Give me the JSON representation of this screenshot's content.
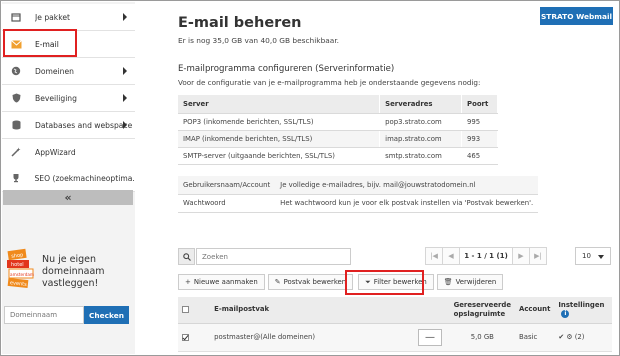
{
  "sidebar": {
    "items": [
      {
        "label": "Je pakket",
        "icon": "box-icon"
      },
      {
        "label": "E-mail",
        "icon": "envelope-icon"
      },
      {
        "label": "Domeinen",
        "icon": "globe-icon"
      },
      {
        "label": "Beveiliging",
        "icon": "shield-icon"
      },
      {
        "label": "Databases and webspace",
        "icon": "database-icon"
      },
      {
        "label": "AppWizard",
        "icon": "wand-icon"
      },
      {
        "label": "SEO (zoekmachineoptima...",
        "icon": "trophy-icon"
      }
    ],
    "collapse_label": "«",
    "promo_text": "Nu je eigen domeinnaam vastleggen!",
    "promo_image_tags": [
      "shop",
      "hotel",
      "amsterdam",
      "events"
    ],
    "domain_placeholder": "Domeinnaam",
    "check_label": "Checken"
  },
  "header": {
    "title": "E-mail beheren",
    "webmail_label": "STRATO Webmail",
    "quota_text": "Er is nog 35,0 GB van 40,0 GB beschikbaar."
  },
  "server_info": {
    "title": "E-mailprogramma configureren (Serverinformatie)",
    "description": "Voor de configuratie van je e-mailprogramma heb je onderstaande gegevens nodig:",
    "headers": [
      "Server",
      "Serveradres",
      "Poort"
    ],
    "rows": [
      [
        "POP3 (inkomende berichten, SSL/TLS)",
        "pop3.strato.com",
        "995"
      ],
      [
        "IMAP (inkomende berichten, SSL/TLS)",
        "imap.strato.com",
        "993"
      ],
      [
        "SMTP-server (uitgaande berichten, SSL/TLS)",
        "smtp.strato.com",
        "465"
      ]
    ],
    "credentials": [
      [
        "Gebruikersnaam/Account",
        "Je volledige e-mailadres, bijv. mail@jouwstratodomein.nl"
      ],
      [
        "Wachtwoord",
        "Het wachtwoord kun je voor elk postvak instellen via 'Postvak bewerken'."
      ]
    ]
  },
  "toolbar": {
    "search_placeholder": "Zoeken",
    "pager": {
      "first": "|◀",
      "prev": "◀",
      "info": "1 - 1 / 1 (1)",
      "next": "▶",
      "last": "▶|"
    },
    "per_page": "10",
    "actions": [
      {
        "label": "Nieuwe aanmaken",
        "icon": "+"
      },
      {
        "label": "Postvak bewerken",
        "icon": "✎"
      },
      {
        "label": "Filter bewerken",
        "icon": "⏷"
      },
      {
        "label": "Verwijderen",
        "icon": "🗑"
      }
    ]
  },
  "mailboxes": {
    "headers": {
      "mailbox": "E-mailpostvak",
      "reserved": "Gereserveerde opslagruimte",
      "account": "Account",
      "settings": "Instellingen"
    },
    "rows": [
      {
        "mailbox": "postmaster@(Alle domeinen)",
        "toggle": "—",
        "reserved": "5,0 GB",
        "account": "Basic",
        "settings": "✔ ⚙ (2)",
        "checked": true
      }
    ]
  }
}
